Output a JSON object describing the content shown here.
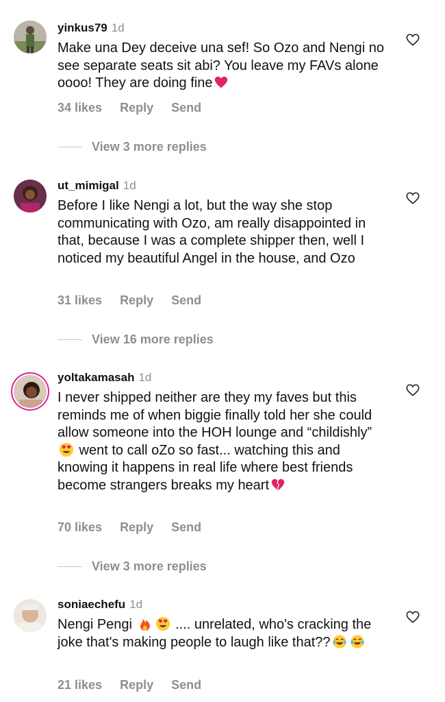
{
  "comments": [
    {
      "username": "yinkus79",
      "time": "1d",
      "text": "Make una Dey deceive una sef! So Ozo and Nengi no see separate seats sit abi? You leave my FAVs alone oooo! They are doing fine",
      "likes": "34 likes",
      "reply": "Reply",
      "send": "Send",
      "view_replies": "View 3 more replies"
    },
    {
      "username": "ut_mimigal",
      "time": "1d",
      "text": "Before I like Nengi a lot, but the way she stop communicating with Ozo, am really disappointed in that, because I was a complete shipper then, well I noticed my beautiful Angel in the house, and  Ozo",
      "likes": "31 likes",
      "reply": "Reply",
      "send": "Send",
      "view_replies": "View 16 more replies"
    },
    {
      "username": "yoltakamasah",
      "time": "1d",
      "text_part1": "I never shipped neither are they my faves but this reminds me of when biggie finally told her she could allow someone into the HOH lounge and “childishly”",
      "text_part2": " went to call oZo so fast... watching this and knowing it happens in real life where best friends become strangers breaks my heart",
      "likes": "70 likes",
      "reply": "Reply",
      "send": "Send",
      "view_replies": "View 3 more replies"
    },
    {
      "username": "soniaechefu",
      "time": "1d",
      "text_part1": "Nengi Pengi",
      "text_part2": " .... unrelated, who's cracking the joke that's making people to laugh like that??",
      "likes": "21 likes",
      "reply": "Reply",
      "send": "Send"
    }
  ],
  "colors": {
    "secondary_text": "#8e8e8e",
    "heart_emoji": "#e0245e",
    "story_ring": "#d6249f"
  }
}
